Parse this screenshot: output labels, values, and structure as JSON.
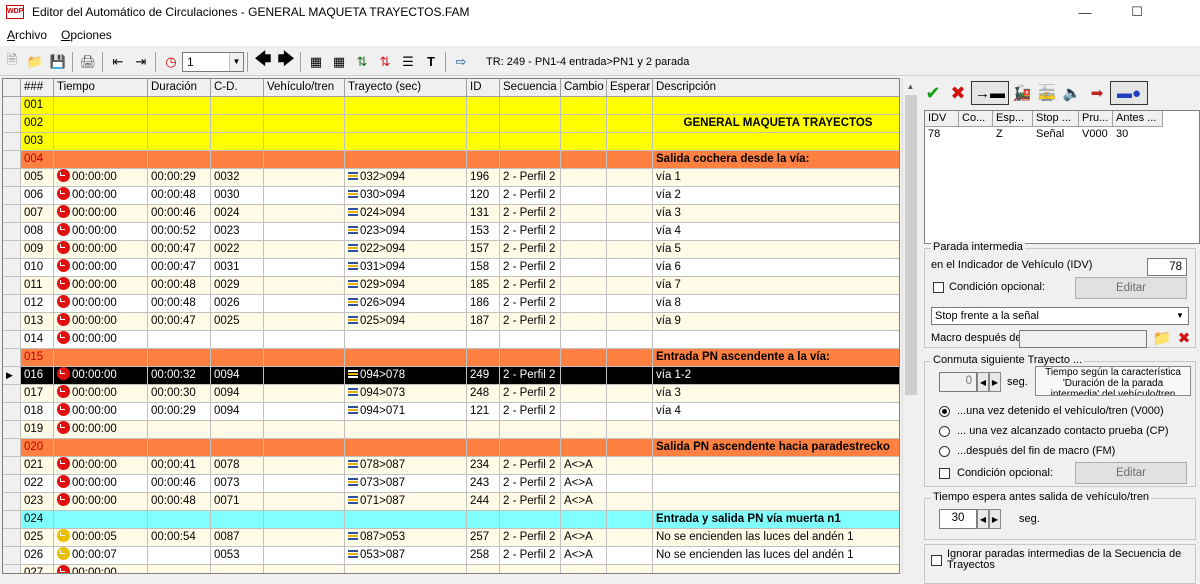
{
  "window": {
    "title": "Editor del Automático de Circulaciones - GENERAL MAQUETA TRAYECTOS.FAM",
    "app_icon_text": "WDP"
  },
  "menu": [
    {
      "label": "Archivo"
    },
    {
      "label": "Opciones"
    }
  ],
  "toolbar": {
    "combo_value": "1",
    "status": "TR: 249 - PN1-4 entrada>PN1 y 2 parada"
  },
  "grid": {
    "headers": [
      "###",
      "Tiempo",
      "Duración",
      "C-D.",
      "Vehículo/tren",
      "Trayecto (sec)",
      "ID",
      "Secuencia",
      "Cambio",
      "Esperar",
      "Descripción"
    ],
    "rows": [
      {
        "num": "001",
        "type": "yellow",
        "desc": ""
      },
      {
        "num": "002",
        "type": "yellow",
        "desc": "GENERAL MAQUETA TRAYECTOS",
        "desc_center": true
      },
      {
        "num": "003",
        "type": "yellow",
        "desc": ""
      },
      {
        "num": "004",
        "type": "orange",
        "desc": "Salida cochera desde la vía:"
      },
      {
        "num": "005",
        "type": "data",
        "clock": "red",
        "time": "00:00:00",
        "dur": "00:00:29",
        "cd": "0032",
        "tray": "032>094",
        "id": "196",
        "seq": "2 - Perfil 2",
        "cambio": "",
        "desc": "vía 1"
      },
      {
        "num": "006",
        "type": "data",
        "clock": "red",
        "time": "00:00:00",
        "dur": "00:00:48",
        "cd": "0030",
        "tray": "030>094",
        "id": "120",
        "seq": "2 - Perfil 2",
        "cambio": "",
        "desc": "vía 2"
      },
      {
        "num": "007",
        "type": "data",
        "clock": "red",
        "time": "00:00:00",
        "dur": "00:00:46",
        "cd": "0024",
        "tray": "024>094",
        "id": "131",
        "seq": "2 - Perfil 2",
        "cambio": "",
        "desc": "vía 3"
      },
      {
        "num": "008",
        "type": "data",
        "clock": "red",
        "time": "00:00:00",
        "dur": "00:00:52",
        "cd": "0023",
        "tray": "023>094",
        "id": "153",
        "seq": "2 - Perfil 2",
        "cambio": "",
        "desc": "vía 4"
      },
      {
        "num": "009",
        "type": "data",
        "clock": "red",
        "time": "00:00:00",
        "dur": "00:00:47",
        "cd": "0022",
        "tray": "022>094",
        "id": "157",
        "seq": "2 - Perfil 2",
        "cambio": "",
        "desc": "vía 5"
      },
      {
        "num": "010",
        "type": "data",
        "clock": "red",
        "time": "00:00:00",
        "dur": "00:00:47",
        "cd": "0031",
        "tray": "031>094",
        "id": "158",
        "seq": "2 - Perfil 2",
        "cambio": "",
        "desc": "vía 6"
      },
      {
        "num": "011",
        "type": "data",
        "clock": "red",
        "time": "00:00:00",
        "dur": "00:00:48",
        "cd": "0029",
        "tray": "029>094",
        "id": "185",
        "seq": "2 - Perfil 2",
        "cambio": "",
        "desc": "vía 7"
      },
      {
        "num": "012",
        "type": "data",
        "clock": "red",
        "time": "00:00:00",
        "dur": "00:00:48",
        "cd": "0026",
        "tray": "026>094",
        "id": "186",
        "seq": "2 - Perfil 2",
        "cambio": "",
        "desc": "vía 8"
      },
      {
        "num": "013",
        "type": "data",
        "clock": "red",
        "time": "00:00:00",
        "dur": "00:00:47",
        "cd": "0025",
        "tray": "025>094",
        "id": "187",
        "seq": "2 - Perfil 2",
        "cambio": "",
        "desc": "vía 9"
      },
      {
        "num": "014",
        "type": "data",
        "clock": "red",
        "time": "00:00:00",
        "dur": "",
        "cd": "",
        "tray": "",
        "id": "",
        "seq": "",
        "cambio": "",
        "desc": ""
      },
      {
        "num": "015",
        "type": "orange",
        "desc": "Entrada PN ascendente a la vía:"
      },
      {
        "num": "016",
        "type": "selected",
        "clock": "red",
        "time": "00:00:00",
        "dur": "00:00:32",
        "cd": "0094",
        "tray": "094>078",
        "id": "249",
        "seq": "2 - Perfil 2",
        "cambio": "",
        "desc": "vía 1-2"
      },
      {
        "num": "017",
        "type": "data",
        "clock": "red",
        "time": "00:00:00",
        "dur": "00:00:30",
        "cd": "0094",
        "tray": "094>073",
        "id": "248",
        "seq": "2 - Perfil 2",
        "cambio": "",
        "desc": "vía 3"
      },
      {
        "num": "018",
        "type": "data",
        "clock": "red",
        "time": "00:00:00",
        "dur": "00:00:29",
        "cd": "0094",
        "tray": "094>071",
        "id": "121",
        "seq": "2 - Perfil 2",
        "cambio": "",
        "desc": "vía 4"
      },
      {
        "num": "019",
        "type": "data",
        "clock": "red",
        "time": "00:00:00",
        "dur": "",
        "cd": "",
        "tray": "",
        "id": "",
        "seq": "",
        "cambio": "",
        "desc": ""
      },
      {
        "num": "020",
        "type": "orange",
        "desc": "Salida PN ascendente hacia paradestrecko"
      },
      {
        "num": "021",
        "type": "data",
        "clock": "red",
        "time": "00:00:00",
        "dur": "00:00:41",
        "cd": "0078",
        "tray": "078>087",
        "id": "234",
        "seq": "2 - Perfil 2",
        "cambio": "A<>A",
        "desc": ""
      },
      {
        "num": "022",
        "type": "data",
        "clock": "red",
        "time": "00:00:00",
        "dur": "00:00:46",
        "cd": "0073",
        "tray": "073>087",
        "id": "243",
        "seq": "2 - Perfil 2",
        "cambio": "A<>A",
        "desc": ""
      },
      {
        "num": "023",
        "type": "data",
        "clock": "red",
        "time": "00:00:00",
        "dur": "00:00:48",
        "cd": "0071",
        "tray": "071>087",
        "id": "244",
        "seq": "2 - Perfil 2",
        "cambio": "A<>A",
        "desc": ""
      },
      {
        "num": "024",
        "type": "cyan",
        "desc": "Entrada y salida PN vía muerta n1"
      },
      {
        "num": "025",
        "type": "data",
        "clock": "yellow",
        "time": "00:00:05",
        "dur": "00:00:54",
        "cd": "0087",
        "tray": "087>053",
        "id": "257",
        "seq": "2 - Perfil 2",
        "cambio": "A<>A",
        "desc": "No se encienden las luces del andén 1"
      },
      {
        "num": "026",
        "type": "data",
        "clock": "yellow",
        "time": "00:00:07",
        "dur": "",
        "cd": "0053",
        "tray": "053>087",
        "id": "258",
        "seq": "2 - Perfil 2",
        "cambio": "A<>A",
        "desc": "No se encienden las luces del andén 1"
      },
      {
        "num": "027",
        "type": "data",
        "clock": "red",
        "time": "00:00:00",
        "dur": "",
        "cd": "",
        "tray": "",
        "id": "",
        "seq": "",
        "cambio": "",
        "desc": ""
      }
    ]
  },
  "idv_table": {
    "headers": [
      "IDV",
      "Co...",
      "Esp...",
      "Stop ...",
      "Pru...",
      "Antes ..."
    ],
    "rows": [
      [
        "78",
        "",
        "Z",
        "Señal",
        "V000",
        "30"
      ]
    ]
  },
  "parada": {
    "group_title": "Parada intermedia",
    "idv_label": "en el Indicador de Vehículo (IDV)",
    "idv_value": "78",
    "cond_label": "Condición opcional:",
    "editar": "Editar",
    "stop_select": "Stop frente a la señal",
    "macro_label": "Macro después de"
  },
  "conmuta": {
    "group_title": "Conmuta siguiente Trayecto ...",
    "seg_value": "0",
    "seg_label": "seg.",
    "note": "Tiempo según la característica 'Duración de la parada intermedia' del vehículo/tren",
    "radio1": "...una vez detenido el vehículo/tren (V000)",
    "radio2": "... una vez alcanzado contacto prueba (CP)",
    "radio3": "...después del fin de macro (FM)",
    "cond_label": "Condición opcional:",
    "editar": "Editar"
  },
  "espera": {
    "group_title": "Tiempo espera antes salida de vehículo/tren",
    "value": "30",
    "seg_label": "seg."
  },
  "ignorar": {
    "label": "Ignorar paradas intermedias de la Secuencia de Trayectos"
  },
  "colors": {
    "yellow": "#ffff00",
    "orange": "#ff8040",
    "cyan": "#80ffff",
    "data_odd": "#fffbe6",
    "data_even": "#fffae0",
    "selected": "#000000"
  }
}
